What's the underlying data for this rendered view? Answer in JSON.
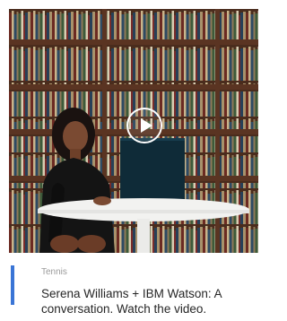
{
  "media": {
    "thumbnail": "video-thumbnail-woman-at-table-before-bookshelves",
    "play_icon": "play-icon"
  },
  "article": {
    "category": "Tennis",
    "title": "Serena Williams + IBM Watson: A conversation. Watch the video."
  },
  "colors": {
    "accent": "#3a75d6",
    "category_text": "#9a9a9a",
    "title_text": "#262626",
    "shelf_wood": "#5a3422"
  }
}
